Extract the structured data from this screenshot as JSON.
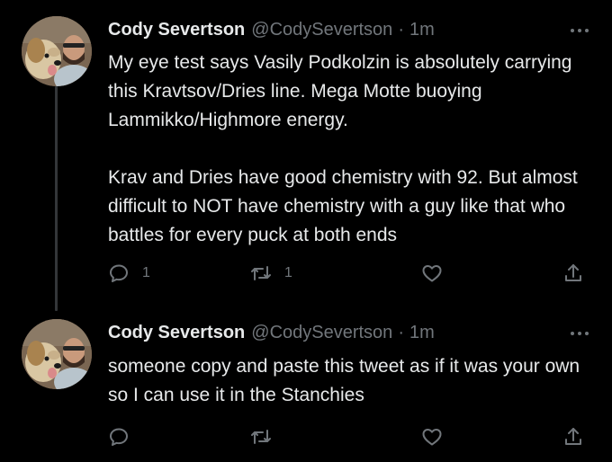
{
  "tweets": [
    {
      "author": {
        "name": "Cody Severtson",
        "handle": "@CodySevertson"
      },
      "separator": "·",
      "time": "1m",
      "paragraphs": [
        "My eye test says Vasily Podkolzin is absolutely carrying this Kravtsov/Dries line. Mega Motte buoying Lammikko/Highmore energy.",
        "Krav and Dries have good chemistry with 92. But almost difficult to NOT have chemistry with a guy like that who battles for every puck at both ends"
      ],
      "stats": {
        "replies": "1",
        "retweets": "1"
      }
    },
    {
      "author": {
        "name": "Cody Severtson",
        "handle": "@CodySevertson"
      },
      "separator": "·",
      "time": "1m",
      "paragraphs": [
        "someone copy and paste this tweet as if it was your own so I can use it in the Stanchies"
      ]
    }
  ],
  "colors": {
    "background": "#000000",
    "text_primary": "#e7e9ea",
    "text_secondary": "#71767b",
    "thread_line": "#333639"
  },
  "icons": {
    "more": "more-horizontal-icon",
    "reply": "speech-bubble-icon",
    "retweet": "retweet-arrows-icon",
    "like": "heart-outline-icon",
    "share": "share-upload-icon"
  }
}
